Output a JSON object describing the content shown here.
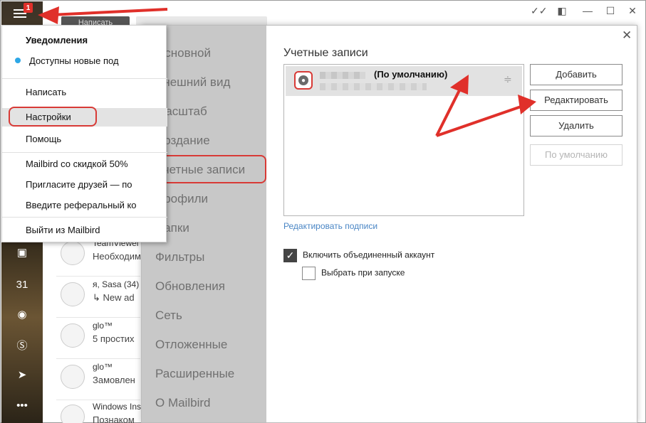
{
  "topbar": {
    "compose_label": "Написать",
    "badge_count": "1"
  },
  "menu": {
    "header": "Уведомления",
    "notification": "Доступны новые под",
    "items": [
      {
        "label": "Написать"
      },
      {
        "label": "Настройки"
      },
      {
        "label": "Помощь"
      },
      {
        "label": "Mailbird со скидкой 50%"
      },
      {
        "label": "Пригласите друзей — по"
      },
      {
        "label": "Введите реферальный ко"
      },
      {
        "label": "Выйти из Mailbird"
      }
    ]
  },
  "mail_list": [
    {
      "from": "TeamViewer",
      "subject": "Необходим"
    },
    {
      "from": "я, Sasa  (34)",
      "subject": "↳ New ad"
    },
    {
      "from": "glo™",
      "subject": "5 простих"
    },
    {
      "from": "glo™",
      "subject": "Замовлен"
    },
    {
      "from": "Windows Ins",
      "subject": "Познаком"
    }
  ],
  "settings": {
    "nav": [
      "Основной",
      "Внешний вид",
      "Масштаб",
      "Создание",
      "Учетные записи",
      "Профили",
      "Папки",
      "Фильтры",
      "Обновления",
      "Сеть",
      "Отложенные",
      "Расширенные",
      "О Mailbird"
    ],
    "accounts_title": "Учетные записи",
    "account": {
      "default_label": "(По умолчанию)"
    },
    "buttons": {
      "add": "Добавить",
      "edit": "Редактировать",
      "delete": "Удалить",
      "set_default": "По умолчанию"
    },
    "signatures_link": "Редактировать подписи",
    "unified_inbox": {
      "label": "Включить объединенный аккаунт",
      "checked": true
    },
    "select_on_start": {
      "label": "Выбрать при запуске",
      "checked": false
    }
  },
  "colors": {
    "annotation": "#e0302a",
    "nav_bg": "#c8c8c8",
    "link": "#4a86c5"
  }
}
